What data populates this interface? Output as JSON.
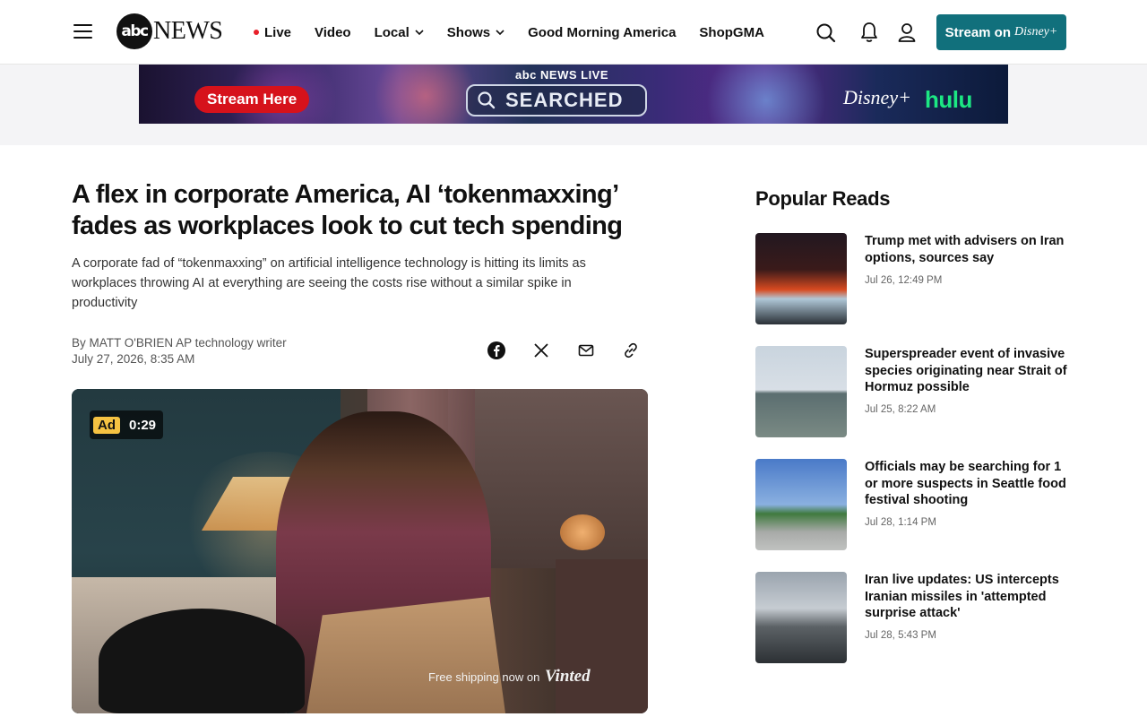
{
  "nav": {
    "logo_abc": "abc",
    "logo_news": "NEWS",
    "links": [
      {
        "label": "Live"
      },
      {
        "label": "Video"
      },
      {
        "label": "Local"
      },
      {
        "label": "Shows"
      },
      {
        "label": "Good Morning America"
      },
      {
        "label": "ShopGMA"
      }
    ],
    "stream_button": {
      "label": "Stream on",
      "brand": "Disney+"
    }
  },
  "banner": {
    "stream_here": "Stream Here",
    "brand": "abc NEWS LIVE",
    "searched": "SEARCHED",
    "disney": "Disney+",
    "hulu": "hulu"
  },
  "article": {
    "headline": "A flex in corporate America, AI ‘tokenmaxxing’ fades as workplaces look to cut tech spending",
    "dek": "A corporate fad of “tokenmaxxing” on artificial intelligence technology is hitting its limits as workplaces throwing AI at everything are seeing the costs rise without a similar spike in productivity",
    "byline": "By MATT O'BRIEN AP technology writer",
    "date": "July 27, 2026, 8:35 AM"
  },
  "video": {
    "ad_label": "Ad",
    "ad_time": "0:29",
    "caption": "Free shipping now on",
    "caption_brand": "Vinted"
  },
  "popular": {
    "title": "Popular Reads",
    "items": [
      {
        "title": "Trump met with advisers on Iran options, sources say",
        "date": "Jul 26, 12:49 PM"
      },
      {
        "title": "Superspreader event of invasive species originating near Strait of Hormuz possible",
        "date": "Jul 25, 8:22 AM"
      },
      {
        "title": "Officials may be searching for 1 or more suspects in Seattle food festival shooting",
        "date": "Jul 28, 1:14 PM"
      },
      {
        "title": "Iran live updates: US intercepts Iranian missiles in 'attempted surprise attack'",
        "date": "Jul 28, 5:43 PM"
      }
    ]
  },
  "colors": {
    "stream_button": "#11707c",
    "live_dot": "#e8202a",
    "ad_badge": "#f5c242"
  }
}
